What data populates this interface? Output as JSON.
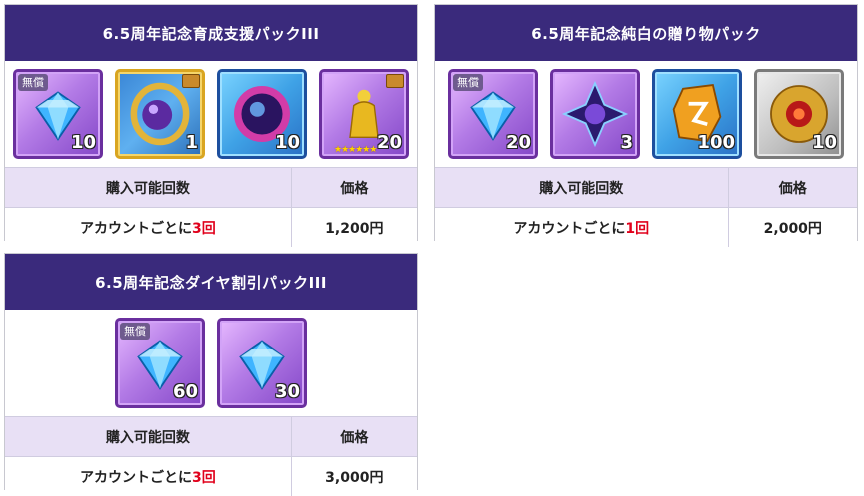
{
  "packs": [
    {
      "title": "6.5周年記念育成支援パックIII",
      "items": [
        {
          "icon": "diamond-icon",
          "badge": "無償",
          "qty": "10"
        },
        {
          "icon": "orb-ring-icon",
          "badge": "",
          "qty": "1"
        },
        {
          "icon": "crystal-orb-icon",
          "badge": "",
          "qty": "10"
        },
        {
          "icon": "gold-statue-icon",
          "badge": "",
          "qty": "20",
          "stars": "★★★★★★"
        }
      ],
      "table": {
        "header_count": "購入可能回数",
        "header_price": "価格",
        "count_prefix": "アカウントごとに",
        "count_value": "3回",
        "price": "1,200円"
      }
    },
    {
      "title": "6.5周年記念純白の贈り物パック",
      "items": [
        {
          "icon": "diamond-icon",
          "badge": "無償",
          "qty": "20"
        },
        {
          "icon": "star-gem-icon",
          "badge": "",
          "qty": "3"
        },
        {
          "icon": "rune-stone-icon",
          "badge": "",
          "qty": "100"
        },
        {
          "icon": "gold-seal-icon",
          "badge": "",
          "qty": "10"
        }
      ],
      "table": {
        "header_count": "購入可能回数",
        "header_price": "価格",
        "count_prefix": "アカウントごとに",
        "count_value": "1回",
        "price": "2,000円"
      }
    },
    {
      "title": "6.5周年記念ダイヤ割引パックIII",
      "items": [
        {
          "icon": "diamond-icon",
          "badge": "無償",
          "qty": "60"
        },
        {
          "icon": "diamond-icon",
          "badge": "",
          "qty": "30"
        }
      ],
      "table": {
        "header_count": "購入可能回数",
        "header_price": "価格",
        "count_prefix": "アカウントごとに",
        "count_value": "3回",
        "price": "3,000円"
      }
    }
  ],
  "colors": {
    "header_bg": "#3a2a7c",
    "table_head_bg": "#e8e0f5",
    "accent_red": "#e0001b"
  }
}
